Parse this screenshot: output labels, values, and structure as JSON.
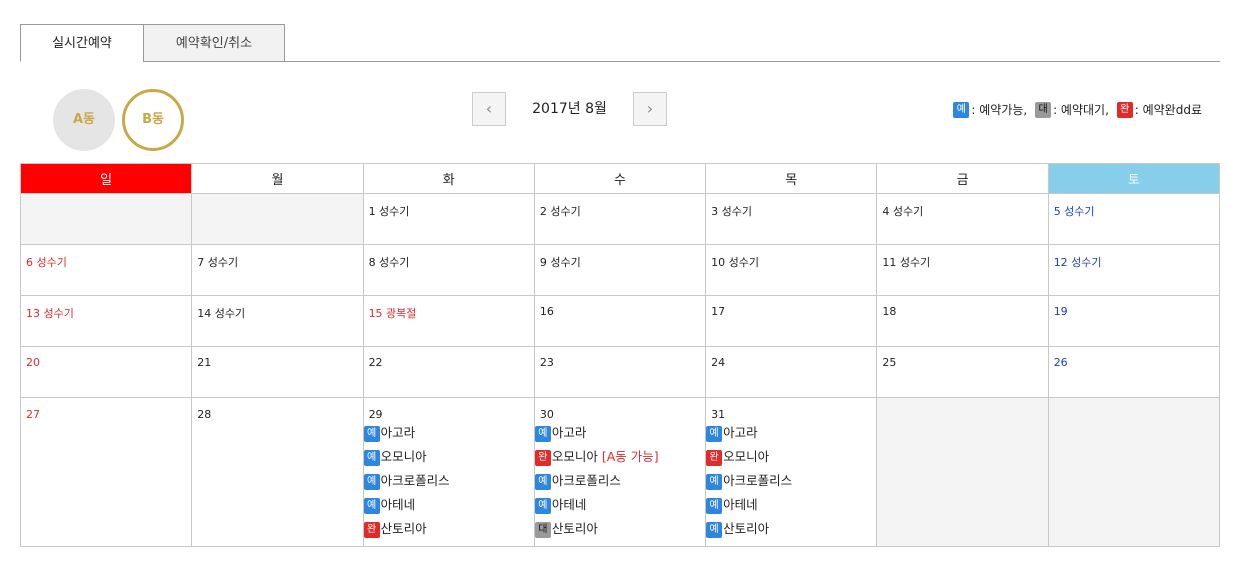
{
  "tabs": [
    "실시간예약",
    "예약확인/취소"
  ],
  "buildings": [
    "A동",
    "B동"
  ],
  "nav": {
    "prev_icon": "chevron-left",
    "next_icon": "chevron-right",
    "month_label": "2017년 8월"
  },
  "legend": {
    "available_badge": "예",
    "available_text": ": 예약가능,",
    "wait_badge": "대",
    "wait_text": ": 예약대기,",
    "done_badge": "완",
    "done_text": ": 예약완dd료"
  },
  "colors": {
    "available": "#2e86de",
    "wait": "#9a9a9a",
    "done": "#e02b2b",
    "sunday": "#ff0000",
    "saturday": "#87ceeb",
    "accent": "#c9a84a"
  },
  "weekdays": [
    "일",
    "월",
    "화",
    "수",
    "목",
    "금",
    "토"
  ],
  "weeks": [
    [
      "",
      "",
      "1 성수기",
      "2 성수기",
      "3 성수기",
      "4 성수기",
      "5 성수기"
    ],
    [
      "6 성수기",
      "7 성수기",
      "8 성수기",
      "9 성수기",
      "10 성수기",
      "11 성수기",
      "12 성수기"
    ],
    [
      "13 성수기",
      "14 성수기",
      "15 광복절",
      "16",
      "17",
      "18",
      "19"
    ],
    [
      "20",
      "21",
      "22",
      "23",
      "24",
      "25",
      "26"
    ],
    [
      "27",
      "28",
      "29",
      "30",
      "31",
      "",
      ""
    ]
  ],
  "reservations": {
    "d29": [
      {
        "badge": "예",
        "name": "아고라"
      },
      {
        "badge": "예",
        "name": "오모니아"
      },
      {
        "badge": "예",
        "name": "아크로폴리스"
      },
      {
        "badge": "예",
        "name": "아테네"
      },
      {
        "badge": "완",
        "name": "산토리아"
      }
    ],
    "d30": [
      {
        "badge": "예",
        "name": "아고라"
      },
      {
        "badge": "완",
        "name": "오모니아",
        "note": "[A동 가능]"
      },
      {
        "badge": "예",
        "name": "아크로폴리스"
      },
      {
        "badge": "예",
        "name": "아테네"
      },
      {
        "badge": "대",
        "name": "산토리아"
      }
    ],
    "d31": [
      {
        "badge": "예",
        "name": "아고라"
      },
      {
        "badge": "완",
        "name": "오모니아"
      },
      {
        "badge": "예",
        "name": "아크로폴리스"
      },
      {
        "badge": "예",
        "name": "아테네"
      },
      {
        "badge": "예",
        "name": "산토리아"
      }
    ]
  }
}
